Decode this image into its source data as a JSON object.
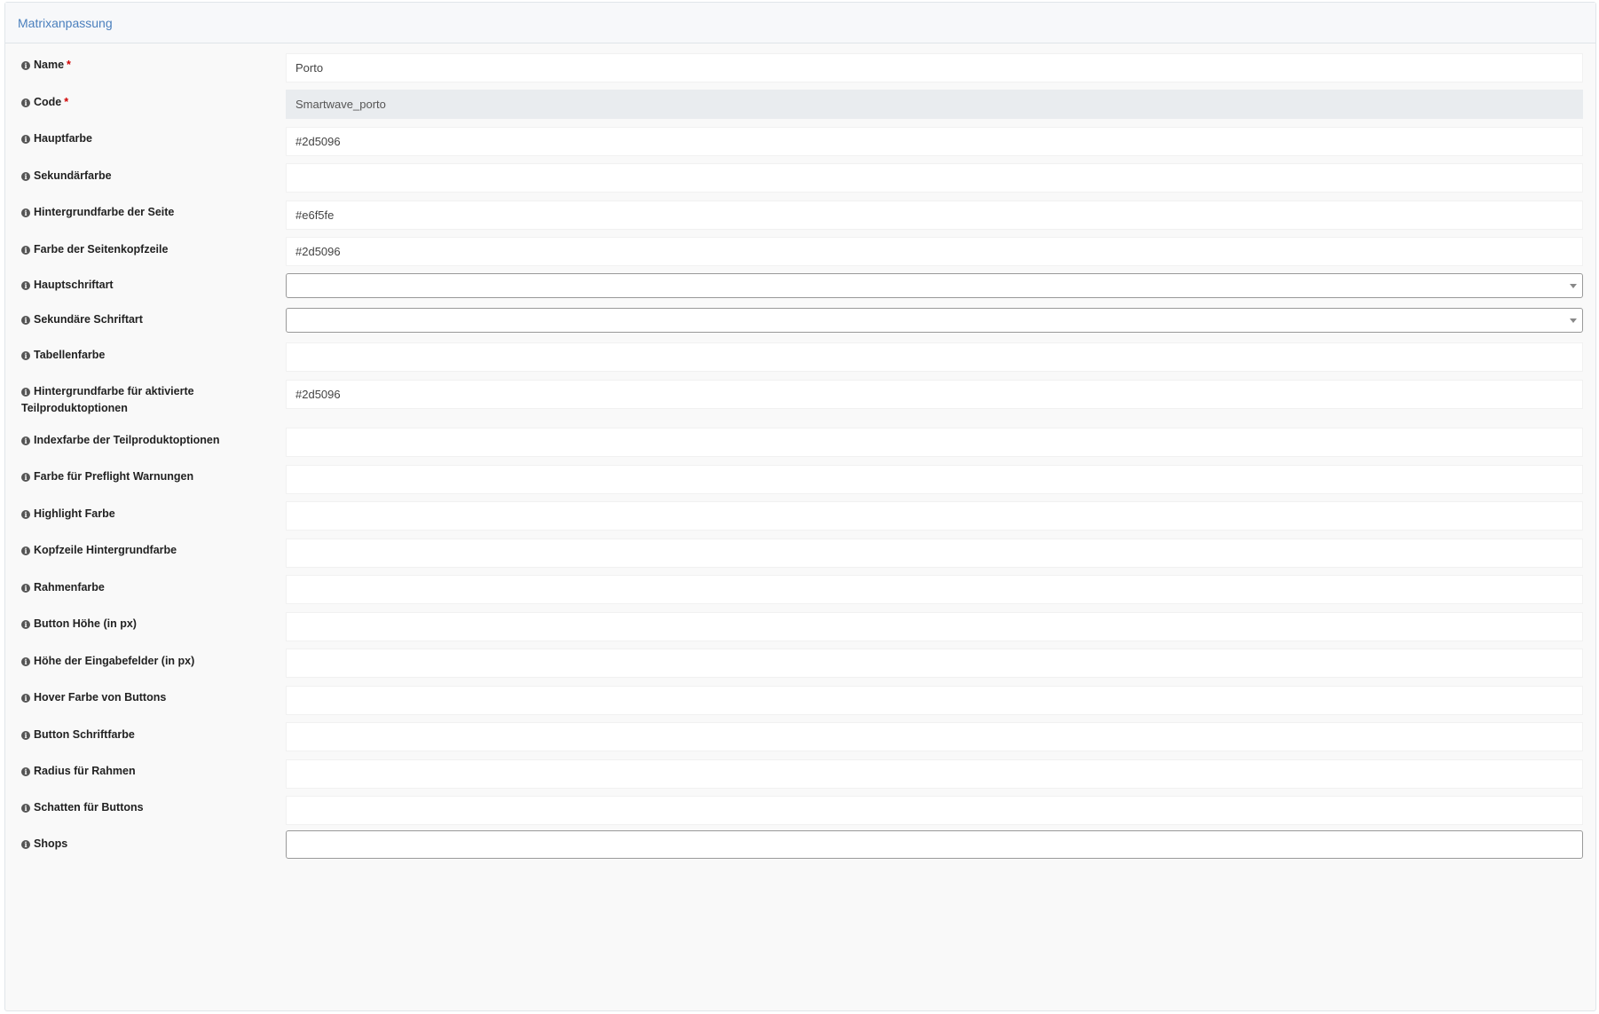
{
  "panel": {
    "title": "Matrixanpassung"
  },
  "fields": [
    {
      "label": "Name",
      "required": "*",
      "value": "Porto"
    },
    {
      "label": "Code",
      "required": "*",
      "value": "Smartwave_porto"
    },
    {
      "label": "Hauptfarbe",
      "value": "#2d5096"
    },
    {
      "label": "Sekundärfarbe",
      "value": ""
    },
    {
      "label": "Hintergrundfarbe der Seite",
      "value": "#e6f5fe"
    },
    {
      "label": "Farbe der Seitenkopfzeile",
      "value": "#2d5096"
    },
    {
      "label": "Hauptschriftart",
      "value": ""
    },
    {
      "label": "Sekundäre Schriftart",
      "value": ""
    },
    {
      "label": "Tabellenfarbe",
      "value": ""
    },
    {
      "label_line1": "Hintergrundfarbe für aktivierte",
      "label_line2": "Teilproduktoptionen",
      "value": "#2d5096"
    },
    {
      "label": "Indexfarbe der Teilproduktoptionen",
      "value": ""
    },
    {
      "label": "Farbe für Preflight Warnungen",
      "value": ""
    },
    {
      "label": "Highlight Farbe",
      "value": ""
    },
    {
      "label": "Kopfzeile Hintergrundfarbe",
      "value": ""
    },
    {
      "label": "Rahmenfarbe",
      "value": ""
    },
    {
      "label": "Button Höhe (in px)",
      "value": ""
    },
    {
      "label": "Höhe der Eingabefelder (in px)",
      "value": ""
    },
    {
      "label": "Hover Farbe von Buttons",
      "value": ""
    },
    {
      "label": "Button Schriftfarbe",
      "value": ""
    },
    {
      "label": "Radius für Rahmen",
      "value": ""
    },
    {
      "label": "Schatten für Buttons",
      "value": ""
    },
    {
      "label": "Shops",
      "value": ""
    }
  ],
  "icons": {
    "info": "info-circle-icon",
    "dropdown": "caret-down-icon"
  },
  "colors": {
    "accent": "#4a7fbd",
    "required": "#d00000"
  }
}
